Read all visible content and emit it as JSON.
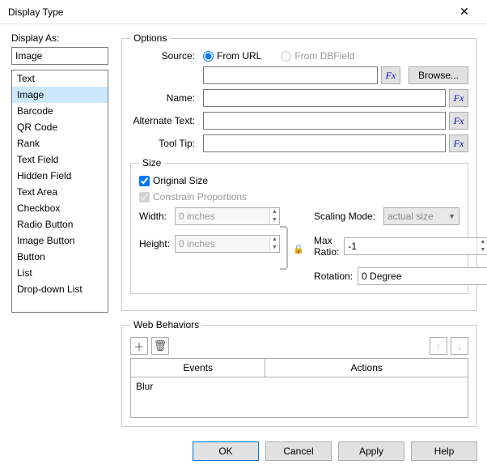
{
  "title": "Display Type",
  "left_panel": {
    "label": "Display As:",
    "current": "Image",
    "items": [
      "Text",
      "Image",
      "Barcode",
      "QR Code",
      "Rank",
      "Text Field",
      "Hidden Field",
      "Text Area",
      "Checkbox",
      "Radio Button",
      "Image Button",
      "Button",
      "List",
      "Drop-down List"
    ],
    "selected_index": 1
  },
  "options": {
    "legend": "Options",
    "source_label": "Source:",
    "source_from_url": "From URL",
    "source_from_dbfield": "From DBField",
    "source_value": "",
    "browse": "Browse...",
    "name_label": "Name:",
    "name_value": "",
    "alt_label": "Alternate Text:",
    "alt_value": "",
    "tooltip_label": "Tool Tip:",
    "tooltip_value": "",
    "fx": "Fx"
  },
  "size": {
    "legend": "Size",
    "original_size": "Original Size",
    "original_size_checked": true,
    "constrain": "Constrain Proportions",
    "constrain_checked": true,
    "width_label": "Width:",
    "width_value": "0 inches",
    "height_label": "Height:",
    "height_value": "0 inches",
    "scaling_label": "Scaling Mode:",
    "scaling_value": "actual size",
    "maxratio_label": "Max Ratio:",
    "maxratio_value": "-1",
    "rotation_label": "Rotation:",
    "rotation_value": "0 Degree"
  },
  "web_behaviors": {
    "legend": "Web Behaviors",
    "events_header": "Events",
    "actions_header": "Actions",
    "rows": [
      {
        "event": "Blur",
        "action": ""
      }
    ]
  },
  "buttons": {
    "ok": "OK",
    "cancel": "Cancel",
    "apply": "Apply",
    "help": "Help"
  }
}
